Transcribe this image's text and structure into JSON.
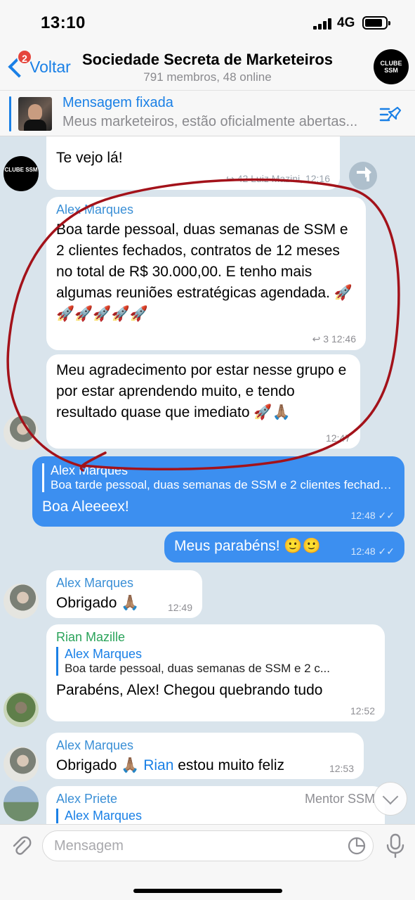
{
  "status": {
    "time": "13:10",
    "network": "4G"
  },
  "header": {
    "back_label": "Voltar",
    "back_badge": "2",
    "title": "Sociedade Secreta de Marketeiros",
    "subtitle": "791 membros, 48 online",
    "group_avatar_text": "CLUBE SSM"
  },
  "pinned": {
    "title": "Mensagem fixada",
    "text": "Meus marketeiros, estão oficialmente abertas..."
  },
  "messages": [
    {
      "id": "m0",
      "direction": "in",
      "text": "Te vejo lá!",
      "meta": "↪ 42 Luiz Mazini, 12:16",
      "avatar": "CLUBE SSM"
    },
    {
      "id": "m1",
      "direction": "in",
      "sender": "Alex Marques",
      "text": "Boa tarde pessoal, duas semanas de SSM e 2 clientes fechados, contratos de 12 meses no total de R$ 30.000,00. E tenho mais algumas reuniões estratégicas agendada. 🚀🚀🚀🚀🚀🚀",
      "meta": "↩ 3  12:46"
    },
    {
      "id": "m2",
      "direction": "in",
      "text": "Meu agradecimento por estar nesse grupo e por estar aprendendo muito, e tendo resultado quase que imediato 🚀🙏🏽",
      "meta": "12:47"
    },
    {
      "id": "m3",
      "direction": "out",
      "quote_name": "Alex Marques",
      "quote_text": "Boa tarde pessoal, duas semanas de SSM e 2 clientes fechados...",
      "text": "Boa Aleeeex!",
      "meta": "12:48 ✓✓"
    },
    {
      "id": "m4",
      "direction": "out",
      "text": "Meus parabéns! 🙂🙂",
      "meta": "12:48 ✓✓"
    },
    {
      "id": "m5",
      "direction": "in",
      "sender": "Alex Marques",
      "text": "Obrigado 🙏🏽",
      "meta": "12:49"
    },
    {
      "id": "m6",
      "direction": "in",
      "sender": "Rian Mazille",
      "quote_name": "Alex Marques",
      "quote_text": "Boa tarde pessoal, duas semanas de SSM e 2 c...",
      "text": "Parabéns, Alex! Chegou quebrando tudo",
      "meta": "12:52"
    },
    {
      "id": "m7",
      "direction": "in",
      "sender": "Alex Marques",
      "text_before": "Obrigado 🙏🏽 ",
      "mention": "Rian",
      "text_after": " estou muito feliz",
      "meta": "12:53"
    },
    {
      "id": "m8",
      "direction": "in",
      "sender": "Alex Priete",
      "role": "Mentor SSM",
      "quote_name": "Alex Marques"
    }
  ],
  "input": {
    "placeholder": "Mensagem"
  },
  "icons": {
    "back": "chevron-left-icon",
    "pinned_list": "pinned-list-icon",
    "attach": "paperclip-icon",
    "sticker": "sticker-icon",
    "mic": "microphone-icon",
    "scroll_down": "chevron-down-icon",
    "forward": "share-icon"
  },
  "colors": {
    "accent": "#1a80e6",
    "outgoing_bubble": "#3c8ff0",
    "chat_background": "#d9e4ec",
    "sender_green": "#2aa35a",
    "annotation_red": "#a3121a"
  }
}
